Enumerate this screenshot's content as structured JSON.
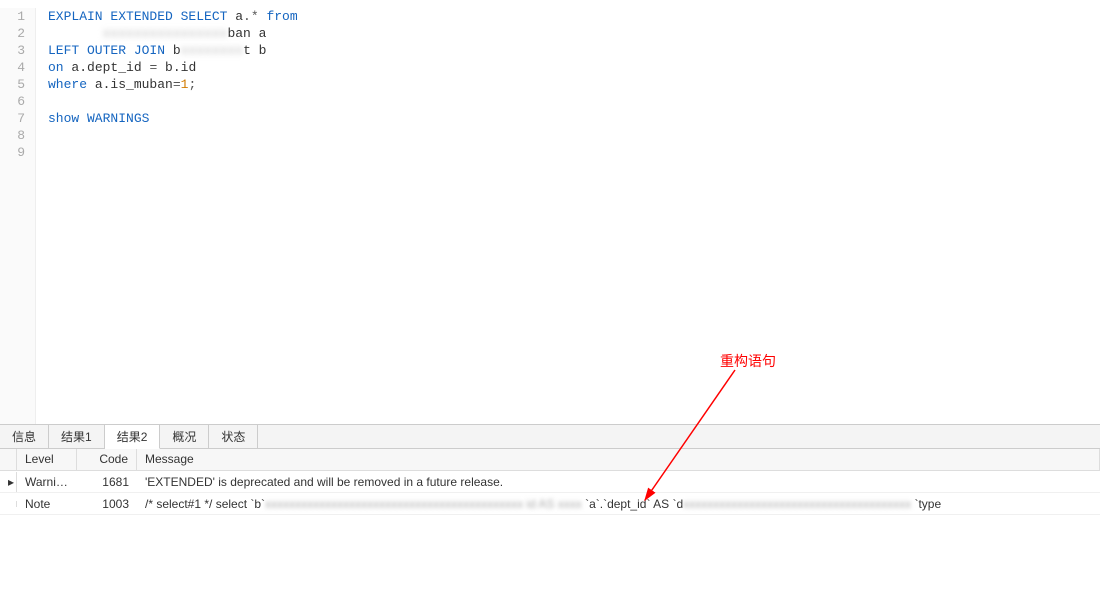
{
  "editor": {
    "lines": [
      {
        "n": 1,
        "tokens": [
          {
            "t": "EXPLAIN EXTENDED SELECT",
            "c": "kw"
          },
          {
            "t": " a",
            "c": "id"
          },
          {
            "t": ".* ",
            "c": "op"
          },
          {
            "t": "from",
            "c": "kw"
          }
        ]
      },
      {
        "n": 2,
        "tokens": [
          {
            "t": "       ",
            "c": "id"
          },
          {
            "t": "xxxxxxxxxxxxxxxx",
            "c": "blur"
          },
          {
            "t": "ban a",
            "c": "id"
          }
        ]
      },
      {
        "n": 3,
        "tokens": [
          {
            "t": "LEFT OUTER JOIN",
            "c": "kw"
          },
          {
            "t": " b",
            "c": "id"
          },
          {
            "t": "xxxxxxxx",
            "c": "blur"
          },
          {
            "t": "t b",
            "c": "id"
          }
        ]
      },
      {
        "n": 4,
        "tokens": [
          {
            "t": "on",
            "c": "kw"
          },
          {
            "t": " a.dept_id ",
            "c": "id"
          },
          {
            "t": "=",
            "c": "op"
          },
          {
            "t": " b.id",
            "c": "id"
          }
        ]
      },
      {
        "n": 5,
        "tokens": [
          {
            "t": "where",
            "c": "kw"
          },
          {
            "t": " a.is_muban",
            "c": "id"
          },
          {
            "t": "=",
            "c": "op"
          },
          {
            "t": "1",
            "c": "num"
          },
          {
            "t": ";",
            "c": "op"
          }
        ]
      },
      {
        "n": 6,
        "tokens": []
      },
      {
        "n": 7,
        "tokens": [
          {
            "t": "show WARNINGS",
            "c": "kw"
          }
        ]
      },
      {
        "n": 8,
        "tokens": []
      },
      {
        "n": 9,
        "tokens": []
      }
    ]
  },
  "resultTabs": [
    {
      "label": "信息",
      "active": false
    },
    {
      "label": "结果1",
      "active": false
    },
    {
      "label": "结果2",
      "active": true
    },
    {
      "label": "概况",
      "active": false
    },
    {
      "label": "状态",
      "active": false
    }
  ],
  "grid": {
    "headers": {
      "level": "Level",
      "code": "Code",
      "message": "Message"
    },
    "rows": [
      {
        "marker": "▸",
        "level": "Warning",
        "code": "1681",
        "message": "'EXTENDED' is deprecated and will be removed in a future release."
      },
      {
        "marker": "",
        "level": "Note",
        "code": "1003",
        "message": "/* select#1 */ select `b`",
        "msgBlur": "xxxxxxxxxxxxxxxxxxxxxxxxxxxxxxxxxxxxxxxxxxx  id  AS  xxxx",
        "msgAfter": " `a`.`dept_id` AS `d",
        "msgBlur2": "xxxxxxxxxxxxxxxxxxxxxxxxxxxxxxxxxxxxxx",
        "msgTail": " `type"
      }
    ]
  },
  "annotation": {
    "label": "重构语句"
  }
}
